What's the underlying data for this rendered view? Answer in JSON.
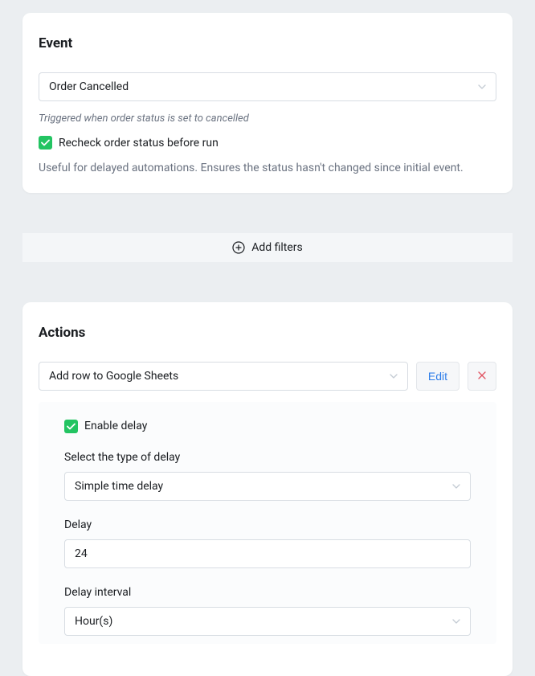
{
  "event": {
    "title": "Event",
    "select_value": "Order Cancelled",
    "help_text": "Triggered when order status is set to cancelled",
    "recheck_label": "Recheck order status before run",
    "description": "Useful for delayed automations. Ensures the status hasn't changed since initial event."
  },
  "add_filters_label": "Add filters",
  "actions": {
    "title": "Actions",
    "select_value": "Add row to Google Sheets",
    "edit_label": "Edit",
    "enable_delay_label": "Enable delay",
    "delay_type_label": "Select the type of delay",
    "delay_type_value": "Simple time delay",
    "delay_label": "Delay",
    "delay_value": "24",
    "delay_interval_label": "Delay interval",
    "delay_interval_value": "Hour(s)"
  }
}
